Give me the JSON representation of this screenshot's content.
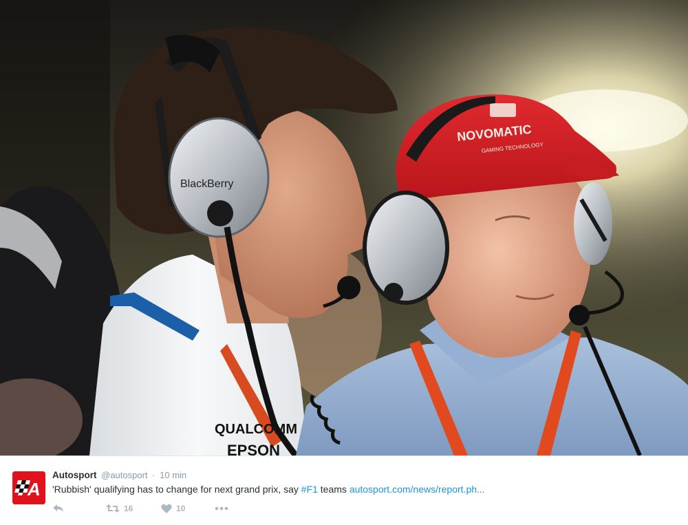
{
  "photo": {
    "headset_brand": "BlackBerry",
    "cap_text": "NOVOMATIC",
    "cap_subtext": "GAMING TECHNOLOGY",
    "shirt_text_1": "QUALCOMM",
    "shirt_text_2": "EPSON"
  },
  "tweet": {
    "avatar_text": "A",
    "fullname": "Autosport",
    "username": "@autosport",
    "separator": "·",
    "time": "10 min",
    "text_main": "'Rubbish' qualifying has to change for next grand prix, say ",
    "hashtag": "#F1",
    "text_after_hashtag": " teams ",
    "link": "autosport.com/news/report.ph...",
    "actions": {
      "reply_icon": "reply-icon",
      "retweet_icon": "retweet-icon",
      "retweet_count": "16",
      "like_icon": "heart-icon",
      "like_count": "10",
      "more_icon": "more-dots-icon"
    }
  },
  "colors": {
    "link": "#1b95e0",
    "muted": "#8899a6",
    "icon": "#aab8c2",
    "avatar_bg": "#e0121b"
  }
}
